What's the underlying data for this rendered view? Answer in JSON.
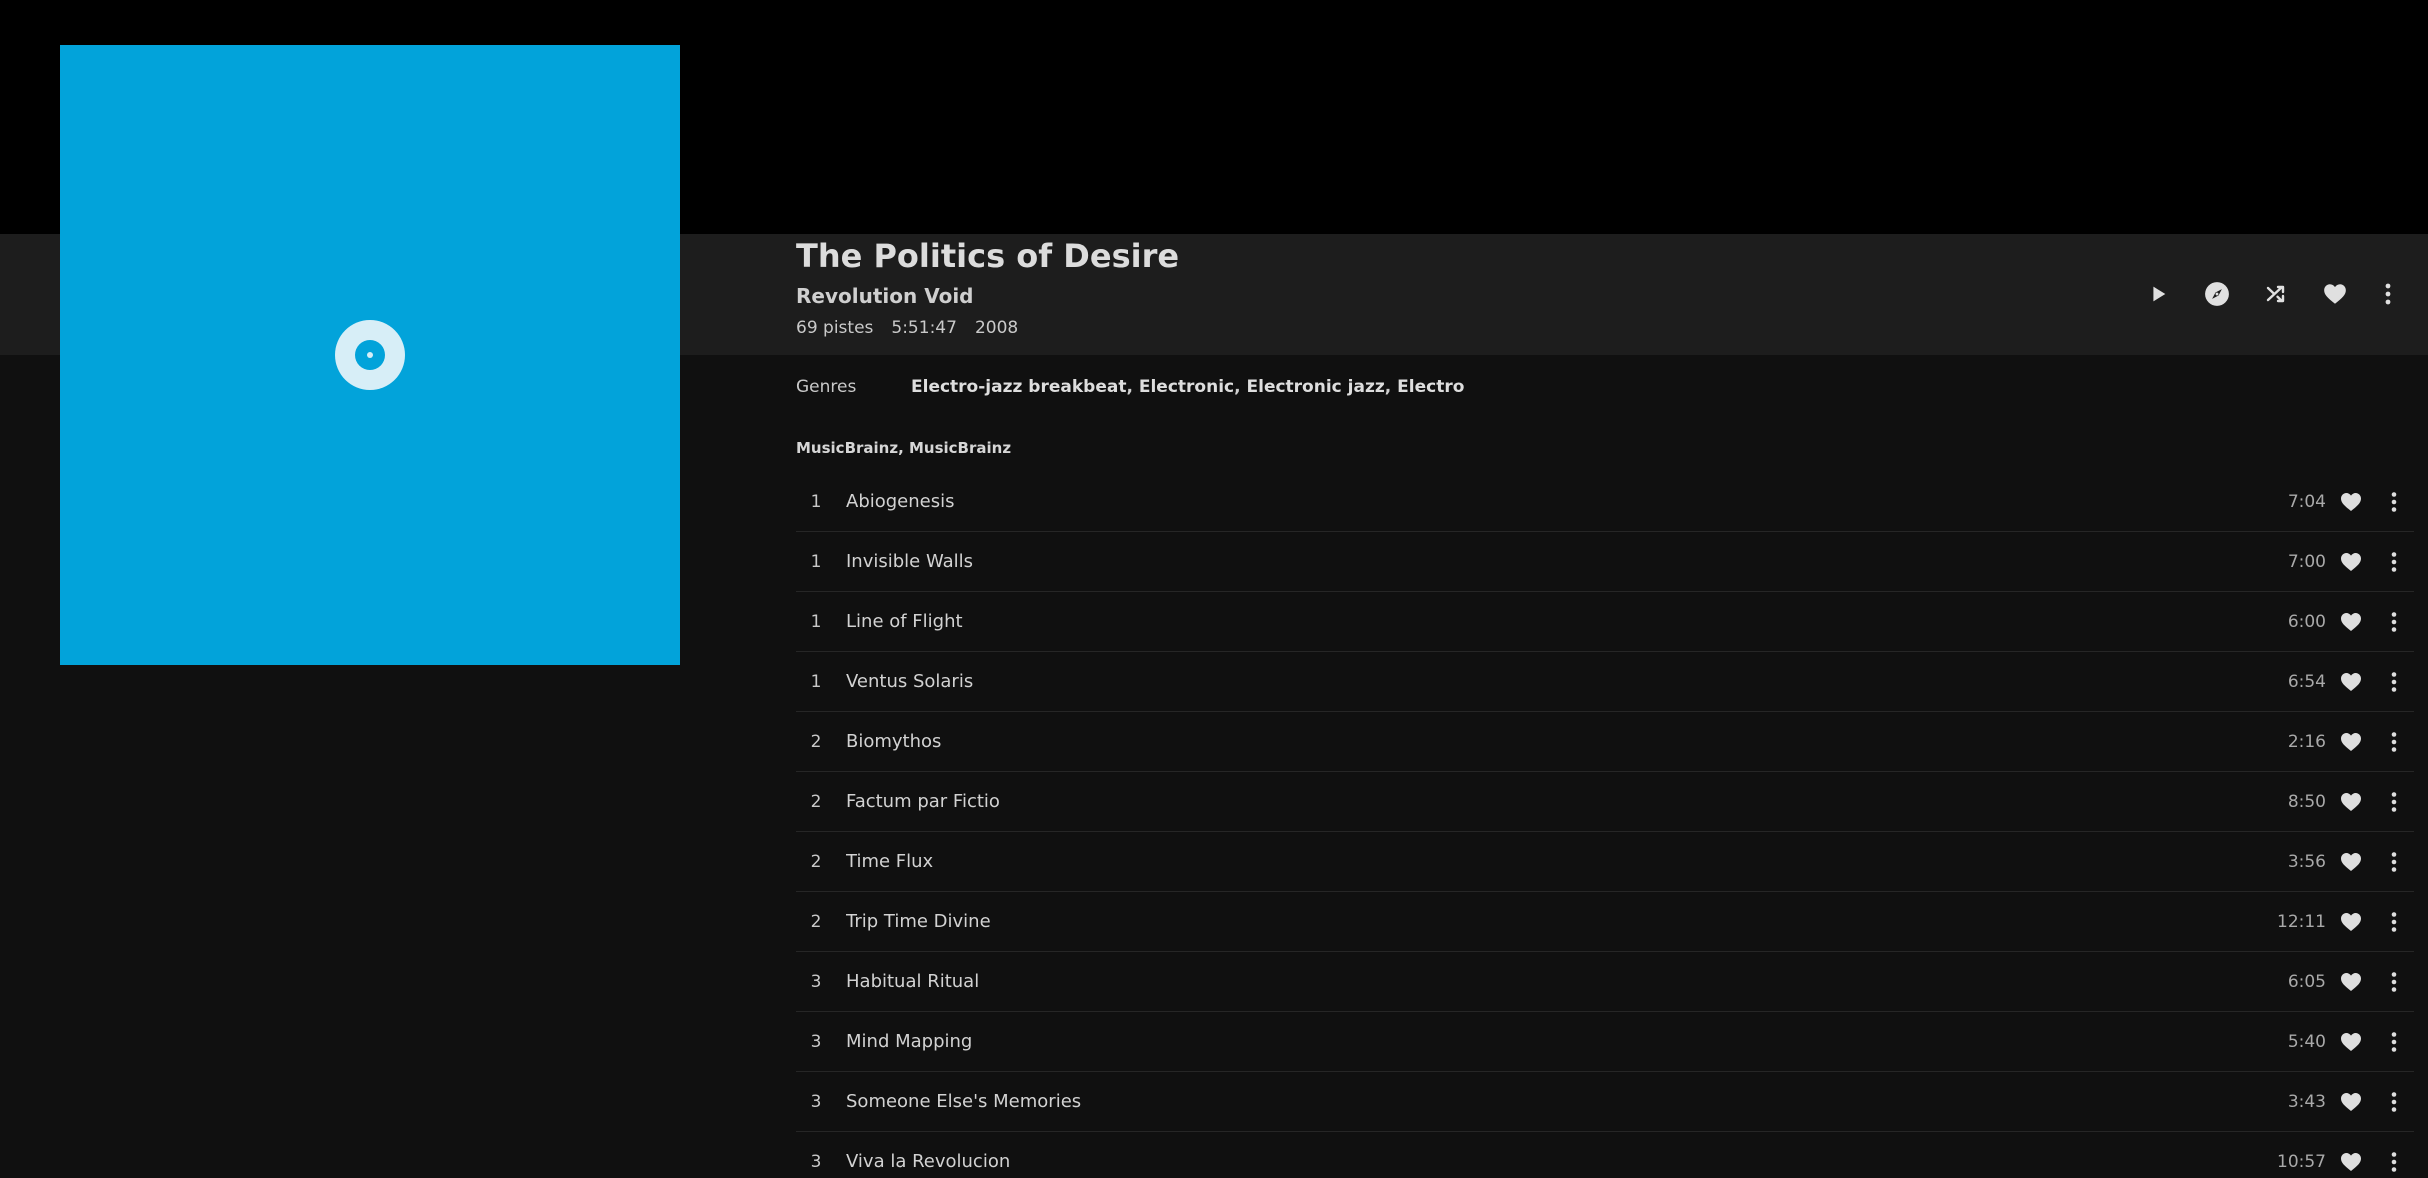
{
  "album": {
    "title": "The Politics of Desire",
    "artist": "Revolution Void",
    "track_count": "69 pistes",
    "duration": "5:51:47",
    "year": "2008",
    "cover_color": "#02a3da"
  },
  "actions": {
    "play_icon": "play-icon",
    "radio_icon": "compass-icon",
    "shuffle_icon": "shuffle-icon",
    "favorite_icon": "heart-icon",
    "more_icon": "more-vertical-icon"
  },
  "genres": {
    "label": "Genres",
    "items": [
      "Electro-jazz breakbeat",
      "Electronic",
      "Electronic jazz",
      "Electro"
    ],
    "separator": ", "
  },
  "sources": "MusicBrainz, MusicBrainz",
  "tracks": [
    {
      "disc": "1",
      "title": "Abiogenesis",
      "duration": "7:04"
    },
    {
      "disc": "1",
      "title": "Invisible Walls",
      "duration": "7:00"
    },
    {
      "disc": "1",
      "title": "Line of Flight",
      "duration": "6:00"
    },
    {
      "disc": "1",
      "title": "Ventus Solaris",
      "duration": "6:54"
    },
    {
      "disc": "2",
      "title": "Biomythos",
      "duration": "2:16"
    },
    {
      "disc": "2",
      "title": "Factum par Fictio",
      "duration": "8:50"
    },
    {
      "disc": "2",
      "title": "Time Flux",
      "duration": "3:56"
    },
    {
      "disc": "2",
      "title": "Trip Time Divine",
      "duration": "12:11"
    },
    {
      "disc": "3",
      "title": "Habitual Ritual",
      "duration": "6:05"
    },
    {
      "disc": "3",
      "title": "Mind Mapping",
      "duration": "5:40"
    },
    {
      "disc": "3",
      "title": "Someone Else's Memories",
      "duration": "3:43"
    },
    {
      "disc": "3",
      "title": "Viva la Revolucion",
      "duration": "10:57"
    }
  ]
}
